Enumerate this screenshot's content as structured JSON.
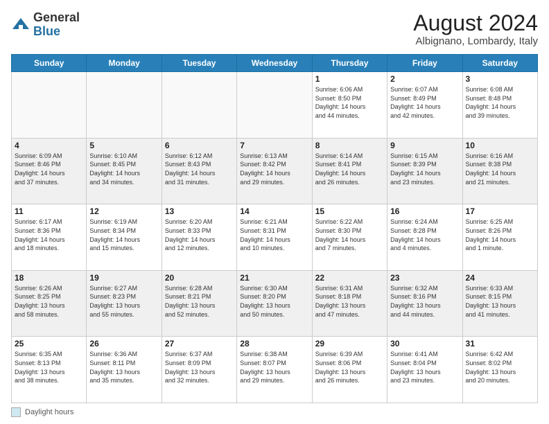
{
  "header": {
    "logo_general": "General",
    "logo_blue": "Blue",
    "month_year": "August 2024",
    "location": "Albignano, Lombardy, Italy"
  },
  "weekdays": [
    "Sunday",
    "Monday",
    "Tuesday",
    "Wednesday",
    "Thursday",
    "Friday",
    "Saturday"
  ],
  "footer": {
    "legend_label": "Daylight hours"
  },
  "weeks": [
    [
      {
        "day": "",
        "info": "",
        "empty": true
      },
      {
        "day": "",
        "info": "",
        "empty": true
      },
      {
        "day": "",
        "info": "",
        "empty": true
      },
      {
        "day": "",
        "info": "",
        "empty": true
      },
      {
        "day": "1",
        "info": "Sunrise: 6:06 AM\nSunset: 8:50 PM\nDaylight: 14 hours\nand 44 minutes."
      },
      {
        "day": "2",
        "info": "Sunrise: 6:07 AM\nSunset: 8:49 PM\nDaylight: 14 hours\nand 42 minutes."
      },
      {
        "day": "3",
        "info": "Sunrise: 6:08 AM\nSunset: 8:48 PM\nDaylight: 14 hours\nand 39 minutes."
      }
    ],
    [
      {
        "day": "4",
        "info": "Sunrise: 6:09 AM\nSunset: 8:46 PM\nDaylight: 14 hours\nand 37 minutes."
      },
      {
        "day": "5",
        "info": "Sunrise: 6:10 AM\nSunset: 8:45 PM\nDaylight: 14 hours\nand 34 minutes."
      },
      {
        "day": "6",
        "info": "Sunrise: 6:12 AM\nSunset: 8:43 PM\nDaylight: 14 hours\nand 31 minutes."
      },
      {
        "day": "7",
        "info": "Sunrise: 6:13 AM\nSunset: 8:42 PM\nDaylight: 14 hours\nand 29 minutes."
      },
      {
        "day": "8",
        "info": "Sunrise: 6:14 AM\nSunset: 8:41 PM\nDaylight: 14 hours\nand 26 minutes."
      },
      {
        "day": "9",
        "info": "Sunrise: 6:15 AM\nSunset: 8:39 PM\nDaylight: 14 hours\nand 23 minutes."
      },
      {
        "day": "10",
        "info": "Sunrise: 6:16 AM\nSunset: 8:38 PM\nDaylight: 14 hours\nand 21 minutes."
      }
    ],
    [
      {
        "day": "11",
        "info": "Sunrise: 6:17 AM\nSunset: 8:36 PM\nDaylight: 14 hours\nand 18 minutes."
      },
      {
        "day": "12",
        "info": "Sunrise: 6:19 AM\nSunset: 8:34 PM\nDaylight: 14 hours\nand 15 minutes."
      },
      {
        "day": "13",
        "info": "Sunrise: 6:20 AM\nSunset: 8:33 PM\nDaylight: 14 hours\nand 12 minutes."
      },
      {
        "day": "14",
        "info": "Sunrise: 6:21 AM\nSunset: 8:31 PM\nDaylight: 14 hours\nand 10 minutes."
      },
      {
        "day": "15",
        "info": "Sunrise: 6:22 AM\nSunset: 8:30 PM\nDaylight: 14 hours\nand 7 minutes."
      },
      {
        "day": "16",
        "info": "Sunrise: 6:24 AM\nSunset: 8:28 PM\nDaylight: 14 hours\nand 4 minutes."
      },
      {
        "day": "17",
        "info": "Sunrise: 6:25 AM\nSunset: 8:26 PM\nDaylight: 14 hours\nand 1 minute."
      }
    ],
    [
      {
        "day": "18",
        "info": "Sunrise: 6:26 AM\nSunset: 8:25 PM\nDaylight: 13 hours\nand 58 minutes."
      },
      {
        "day": "19",
        "info": "Sunrise: 6:27 AM\nSunset: 8:23 PM\nDaylight: 13 hours\nand 55 minutes."
      },
      {
        "day": "20",
        "info": "Sunrise: 6:28 AM\nSunset: 8:21 PM\nDaylight: 13 hours\nand 52 minutes."
      },
      {
        "day": "21",
        "info": "Sunrise: 6:30 AM\nSunset: 8:20 PM\nDaylight: 13 hours\nand 50 minutes."
      },
      {
        "day": "22",
        "info": "Sunrise: 6:31 AM\nSunset: 8:18 PM\nDaylight: 13 hours\nand 47 minutes."
      },
      {
        "day": "23",
        "info": "Sunrise: 6:32 AM\nSunset: 8:16 PM\nDaylight: 13 hours\nand 44 minutes."
      },
      {
        "day": "24",
        "info": "Sunrise: 6:33 AM\nSunset: 8:15 PM\nDaylight: 13 hours\nand 41 minutes."
      }
    ],
    [
      {
        "day": "25",
        "info": "Sunrise: 6:35 AM\nSunset: 8:13 PM\nDaylight: 13 hours\nand 38 minutes."
      },
      {
        "day": "26",
        "info": "Sunrise: 6:36 AM\nSunset: 8:11 PM\nDaylight: 13 hours\nand 35 minutes."
      },
      {
        "day": "27",
        "info": "Sunrise: 6:37 AM\nSunset: 8:09 PM\nDaylight: 13 hours\nand 32 minutes."
      },
      {
        "day": "28",
        "info": "Sunrise: 6:38 AM\nSunset: 8:07 PM\nDaylight: 13 hours\nand 29 minutes."
      },
      {
        "day": "29",
        "info": "Sunrise: 6:39 AM\nSunset: 8:06 PM\nDaylight: 13 hours\nand 26 minutes."
      },
      {
        "day": "30",
        "info": "Sunrise: 6:41 AM\nSunset: 8:04 PM\nDaylight: 13 hours\nand 23 minutes."
      },
      {
        "day": "31",
        "info": "Sunrise: 6:42 AM\nSunset: 8:02 PM\nDaylight: 13 hours\nand 20 minutes."
      }
    ]
  ]
}
